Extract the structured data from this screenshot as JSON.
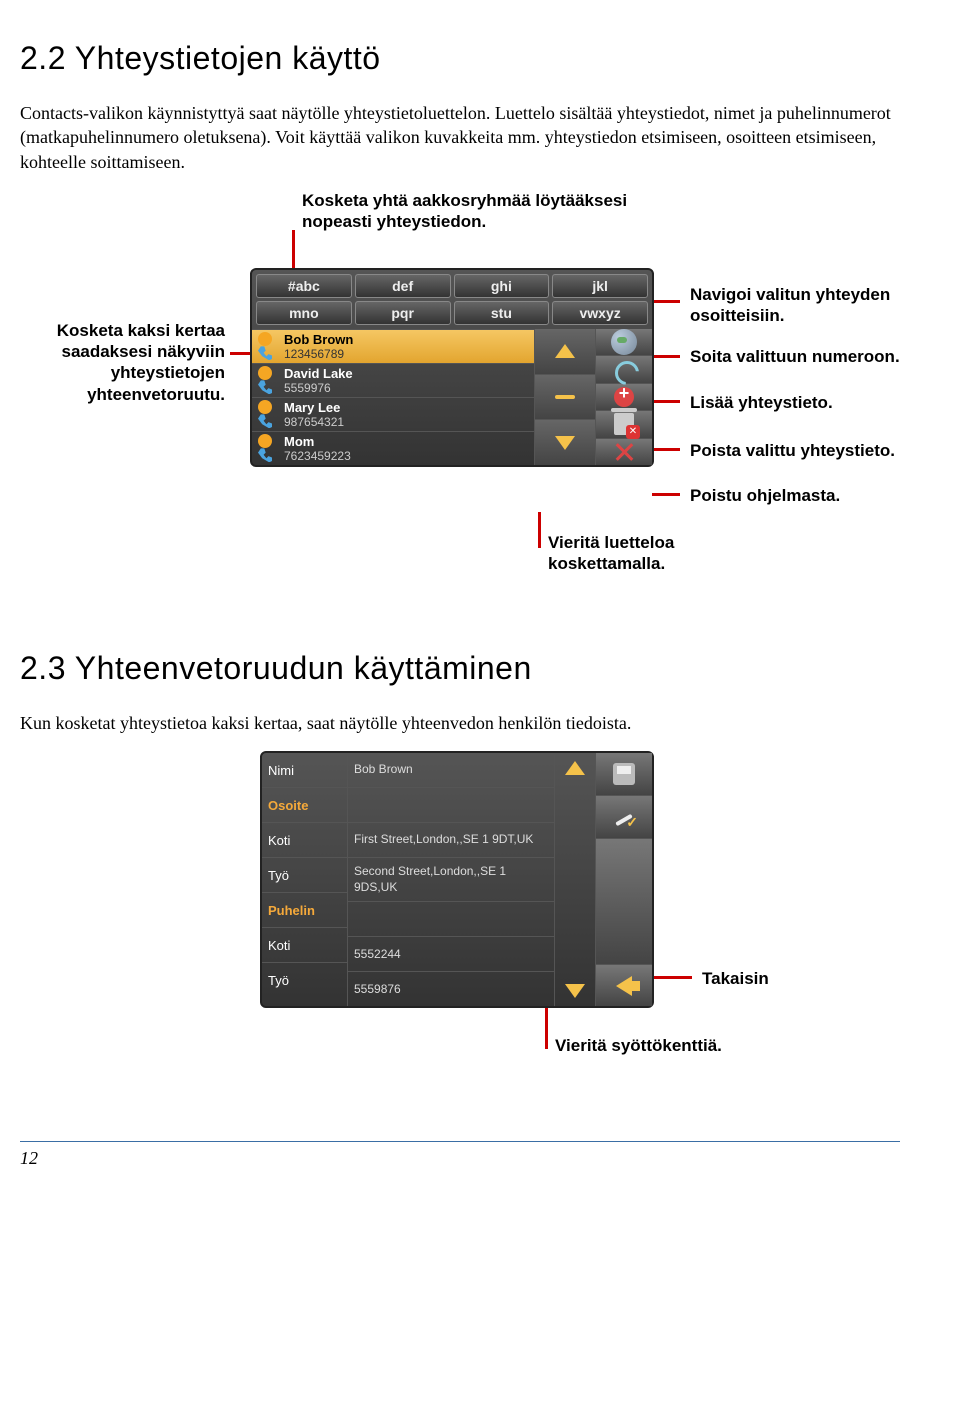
{
  "section22": {
    "heading": "2.2  Yhteystietojen käyttö",
    "para": "Contacts-valikon käynnistyttyä saat näytölle yhteystietoluettelon. Luettelo sisältää yhteystiedot, nimet ja puhelinnumerot (matkapuhelinnumero oletuksena). Voit käyttää valikon kuvakkeita mm. yhteystiedon etsimiseen, osoitteen etsimiseen, kohteelle soittamiseen."
  },
  "fig1": {
    "keys": [
      "#abc",
      "def",
      "ghi",
      "jkl",
      "mno",
      "pqr",
      "stu",
      "vwxyz"
    ],
    "contacts": [
      {
        "name": "Bob Brown",
        "num": "123456789",
        "sel": true
      },
      {
        "name": "David Lake",
        "num": "5559976",
        "sel": false
      },
      {
        "name": "Mary Lee",
        "num": "987654321",
        "sel": false
      },
      {
        "name": "Mom",
        "num": "7623459223",
        "sel": false
      }
    ],
    "callouts": {
      "top": "Kosketa yhtä aakkosryhmää löytääksesi nopeasti yhteystiedon.",
      "left": "Kosketa kaksi kertaa saadaksesi näkyviin yhteystietojen yhteenvetoruutu.",
      "r1": "Navigoi valitun yhteyden osoitteisiin.",
      "r2": "Soita valittuun numeroon.",
      "r3": "Lisää yhteystieto.",
      "r4": "Poista valittu yhteystieto.",
      "r5": "Poistu ohjelmasta.",
      "bottom": "Vieritä luetteloa koskettamalla."
    }
  },
  "section23": {
    "heading": "2.3  Yhteenvetoruudun käyttäminen",
    "para": "Kun kosketat yhteystietoa kaksi kertaa, saat näytölle yhteenvedon henkilön tiedoista."
  },
  "fig2": {
    "rows": [
      {
        "label": "Nimi",
        "value": "Bob Brown",
        "orange": false
      },
      {
        "label": "Osoite",
        "value": "",
        "orange": true
      },
      {
        "label": "Koti",
        "value": "First Street,London,,SE 1 9DT,UK",
        "orange": false
      },
      {
        "label": "Työ",
        "value": "Second Street,London,,SE 1 9DS,UK",
        "orange": false
      },
      {
        "label": "Puhelin",
        "value": "",
        "orange": true
      },
      {
        "label": "Koti",
        "value": "5552244",
        "orange": false
      },
      {
        "label": "Työ",
        "value": "5559876",
        "orange": false
      }
    ],
    "callouts": {
      "back": "Takaisin",
      "scroll": "Vieritä syöttökenttiä."
    }
  },
  "page": "12"
}
